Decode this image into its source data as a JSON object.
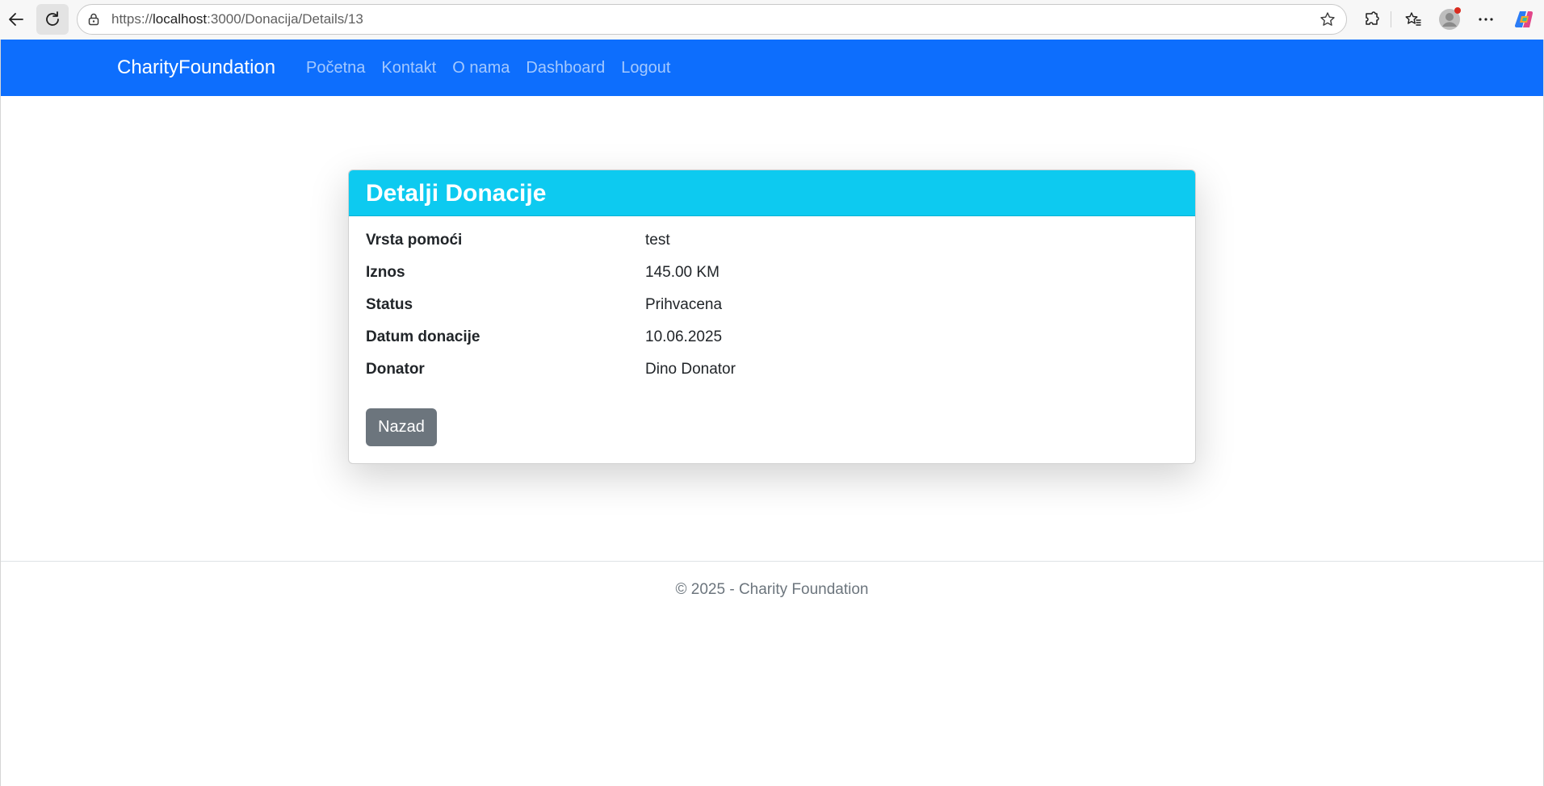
{
  "browser": {
    "url_prefix": "https://",
    "url_host": "localhost",
    "url_rest": ":3000/Donacija/Details/13"
  },
  "navbar": {
    "brand": "CharityFoundation",
    "links": [
      "Početna",
      "Kontakt",
      "O nama",
      "Dashboard",
      "Logout"
    ],
    "color": "#0d6efd"
  },
  "card": {
    "title": "Detalji Donacije",
    "header_color": "#0dcaf0",
    "rows": [
      {
        "label": "Vrsta pomoći",
        "value": "test"
      },
      {
        "label": "Iznos",
        "value": "145.00 KM"
      },
      {
        "label": "Status",
        "value": "Prihvacena"
      },
      {
        "label": "Datum donacije",
        "value": "10.06.2025"
      },
      {
        "label": "Donator",
        "value": "Dino Donator"
      }
    ],
    "back_button": "Nazad"
  },
  "footer": {
    "text": "© 2025 - Charity Foundation"
  }
}
